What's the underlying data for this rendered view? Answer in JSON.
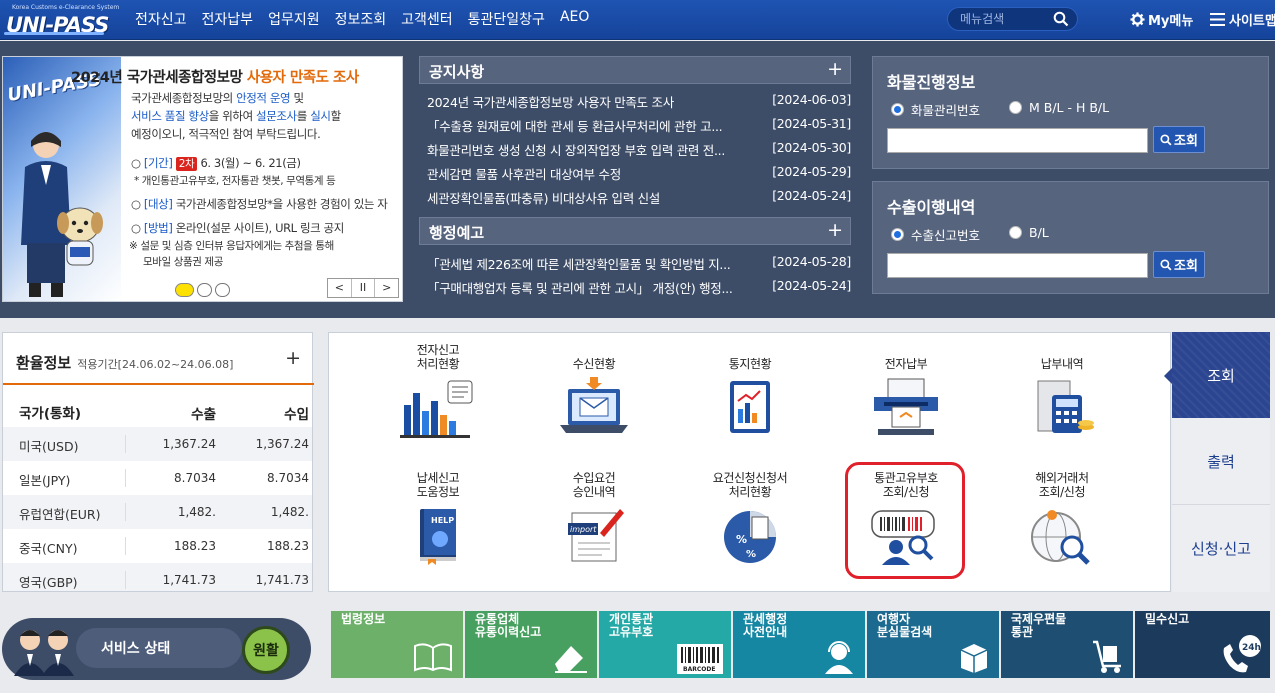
{
  "header": {
    "logo_sub": "Korea Customs e-Clearance System",
    "logo_text": "UNI-PASS",
    "nav": [
      "전자신고",
      "전자납부",
      "업무지원",
      "정보조회",
      "고객센터",
      "통관단일창구",
      "AEO"
    ],
    "search_placeholder": "메뉴검색",
    "my_menu": "My메뉴",
    "sitemap": "사이트맵"
  },
  "banner": {
    "title_pre": "2024년 국가관세종합정보망 ",
    "title_hl": "사용자 만족도 조사",
    "desc1_a": "국가관세종합정보망의 ",
    "desc1_b": "안정적 운영",
    "desc1_c": " 및",
    "desc2_a": "서비스 품질 향상",
    "desc2_b": "을 위하여 ",
    "desc2_c": "설문조사",
    "desc2_d": "를 ",
    "desc2_e": "실시",
    "desc2_f": "할",
    "desc3": "예정이오니, 적극적인 참여 부탁드립니다.",
    "period_tag": "[기간]",
    "period_badge": "2차",
    "period_text": " 6. 3(월) ~ 6. 21(금)",
    "period_note": "* 개인통관고유부호, 전자통관 챗봇, 무역통계 등",
    "target_tag": "[대상]",
    "target_text": " 국가관세종합정보망*을 사용한 경험이 있는 자",
    "method_tag": "[방법]",
    "method_text": " 온라인(설문 사이트), URL 링크 공지",
    "note1": "※ 설문 및 심층 인터뷰 응답자에게는 추첨을 통해",
    "note2": "모바일 상품권 제공",
    "ctrl": [
      "<",
      "II",
      ">"
    ]
  },
  "notice": {
    "title": "공지사항",
    "plus": "+",
    "items": [
      {
        "title": "2024년 국가관세종합정보망 사용자 만족도 조사",
        "date": "[2024-06-03]"
      },
      {
        "title": "「수출용 원재료에 대한 관세 등 환급사무처리에 관한 고...",
        "date": "[2024-05-31]"
      },
      {
        "title": "화물관리번호 생성 신청 시 장외작업장 부호 입력 관련 전...",
        "date": "[2024-05-30]"
      },
      {
        "title": "관세감면 물품 사후관리 대상여부 수정",
        "date": "[2024-05-29]"
      },
      {
        "title": "세관장확인물품(파충류) 비대상사유 입력 신설",
        "date": "[2024-05-24]"
      }
    ]
  },
  "preannounce": {
    "title": "행정예고",
    "plus": "+",
    "items": [
      {
        "title": "「관세법 제226조에 따른 세관장확인물품 및 확인방법 지...",
        "date": "[2024-05-28]"
      },
      {
        "title": "「구매대행업자 등록 및 관리에 관한 고시」 개정(안) 행정...",
        "date": "[2024-05-24]"
      }
    ]
  },
  "cargo": {
    "title": "화물진행정보",
    "radio1": "화물관리번호",
    "radio2": "M B/L - H B/L",
    "button": "조회"
  },
  "export": {
    "title": "수출이행내역",
    "radio1": "수출신고번호",
    "radio2": "B/L",
    "button": "조회"
  },
  "fx": {
    "title": "환율정보",
    "period": "적용기간[24.06.02~24.06.08]",
    "plus": "+",
    "headers": [
      "국가(통화)",
      "수출",
      "수입"
    ],
    "rows": [
      [
        "미국(USD)",
        "1,367.24",
        "1,367.24"
      ],
      [
        "일본(JPY)",
        "8.7034",
        "8.7034"
      ],
      [
        "유럽연합(EUR)",
        "1,482.",
        "1,482."
      ],
      [
        "중국(CNY)",
        "188.23",
        "188.23"
      ],
      [
        "영국(GBP)",
        "1,741.73",
        "1,741.73"
      ]
    ]
  },
  "services": [
    "전자신고\n처리현황",
    "수신현황",
    "통지현황",
    "전자납부",
    "납부내역",
    "납세신고\n도움정보",
    "수입요건\n승인내역",
    "요건신청신청서\n처리현황",
    "통관고유부호\n조회/신청",
    "해외거래처\n조회/신청"
  ],
  "service_icon_text": {
    "help": "HELP",
    "import": "import"
  },
  "tabs": [
    "조회",
    "출력",
    "신청·신고"
  ],
  "status": {
    "label": "서비스 상태",
    "value": "원활"
  },
  "quicklinks": [
    {
      "label": "법령정보",
      "color": "#6cb06a"
    },
    {
      "label": "유통업체\n유통이력신고",
      "color": "#47a05f"
    },
    {
      "label": "개인통관\n고유부호",
      "color": "#25a9a6",
      "icon_text": "BARCODE"
    },
    {
      "label": "관세행정\n사전안내",
      "color": "#1687a3"
    },
    {
      "label": "여행자\n분실물검색",
      "color": "#1c6a90"
    },
    {
      "label": "국제우편물\n통관",
      "color": "#1e4f72"
    },
    {
      "label": "밀수신고",
      "color": "#1c3a5c",
      "icon_text": "24h"
    }
  ]
}
